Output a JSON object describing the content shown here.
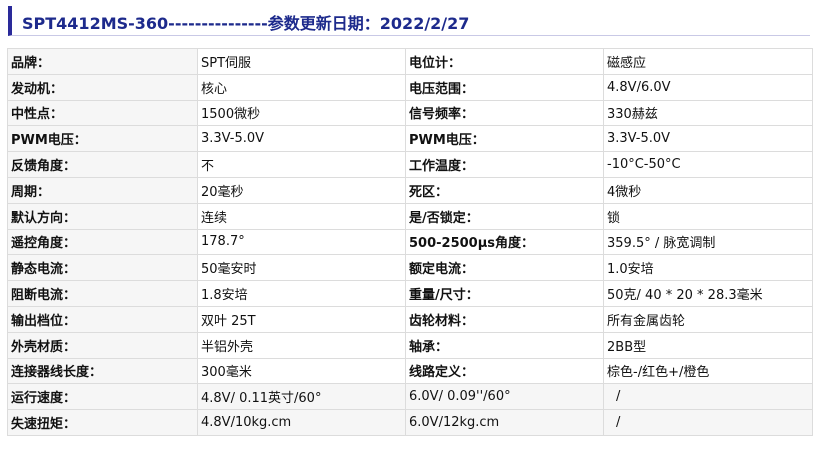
{
  "header": {
    "title": "SPT4412MS-360---------------参数更新日期：2022/2/27"
  },
  "spec_rows": [
    {
      "label_left": "品牌：",
      "value_left": "SPT伺服",
      "label_right": "电位计：",
      "value_right": "磁感应"
    },
    {
      "label_left": "发动机：",
      "value_left": "核心",
      "label_right": "电压范围：",
      "value_right": "4.8V/6.0V"
    },
    {
      "label_left": "中性点：",
      "value_left": "1500微秒",
      "label_right": "信号频率：",
      "value_right": "330赫兹"
    },
    {
      "label_left": "PWM电压：",
      "value_left": "3.3V-5.0V",
      "label_right": "PWM电压：",
      "value_right": "3.3V-5.0V"
    },
    {
      "label_left": "反馈角度：",
      "value_left": "不",
      "label_right": "工作温度：",
      "value_right": "-10°C-50°C"
    },
    {
      "label_left": "周期：",
      "value_left": "20毫秒",
      "label_right": "死区：",
      "value_right": "4微秒"
    },
    {
      "label_left": "默认方向：",
      "value_left": "连续",
      "label_right": "是/否锁定：",
      "value_right": "锁"
    },
    {
      "label_left": "遥控角度：",
      "value_left": "178.7°",
      "label_right": "500-2500μs角度：",
      "value_right": "359.5° / 脉宽调制"
    },
    {
      "label_left": "静态电流：",
      "value_left": "50毫安时",
      "label_right": "额定电流：",
      "value_right": "1.0安培"
    },
    {
      "label_left": "阻断电流：",
      "value_left": "1.8安培",
      "label_right": "重量/尺寸：",
      "value_right": "50克/ 40 * 20 * 28.3毫米"
    },
    {
      "label_left": "输出档位：",
      "value_left": "双叶 25T",
      "label_right": "齿轮材料：",
      "value_right": "所有金属齿轮"
    },
    {
      "label_left": "外壳材质：",
      "value_left": "半铝外壳",
      "label_right": "轴承：",
      "value_right": "2BB型"
    },
    {
      "label_left": "连接器线长度：",
      "value_left": "300毫米",
      "label_right": "线路定义：",
      "value_right": "棕色-/红色+/橙色"
    }
  ],
  "perf_rows": [
    {
      "label": "运行速度：",
      "v48": "4.8V/ 0.11英寸/60°",
      "v60": "6.0V/ 0.09''/60°",
      "extra": "/"
    },
    {
      "label": "失速扭矩：",
      "v48": "4.8V/10kg.cm",
      "v60": "6.0V/12kg.cm",
      "extra": "/"
    }
  ]
}
